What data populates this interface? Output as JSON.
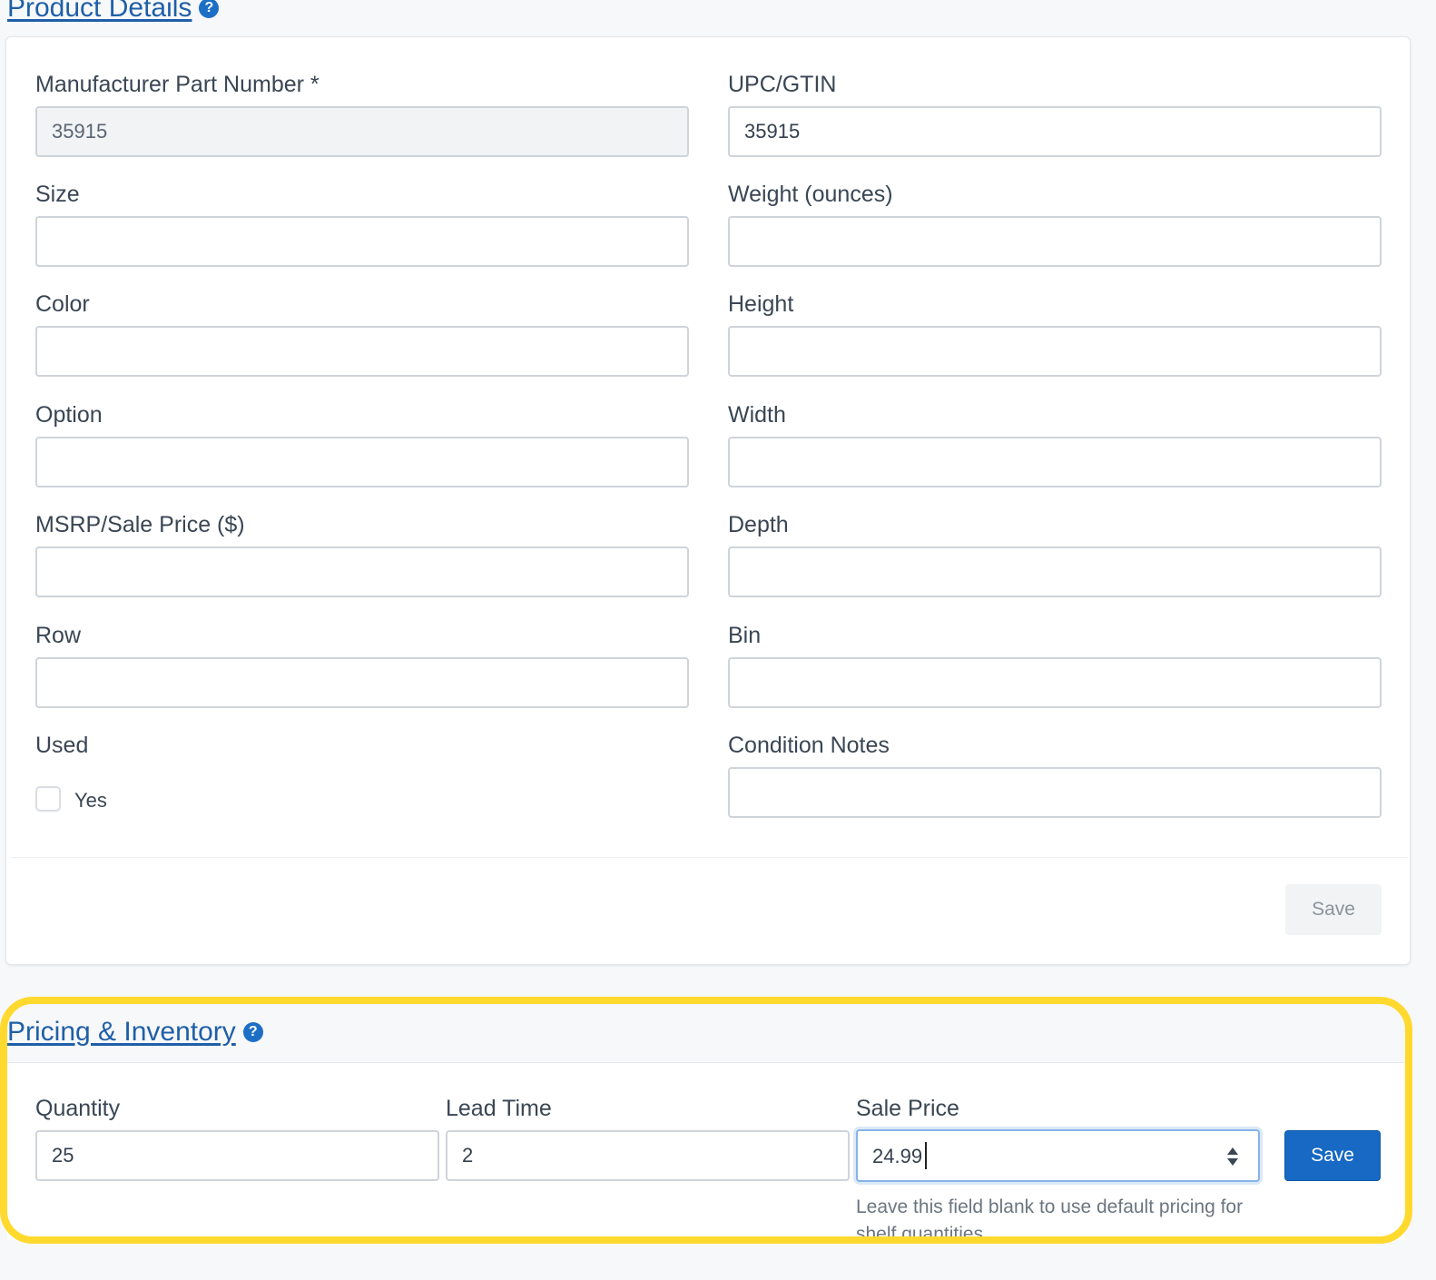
{
  "product_details": {
    "heading": "Product Details",
    "fields": {
      "mpn": {
        "label": "Manufacturer Part Number *",
        "value": "35915"
      },
      "upc": {
        "label": "UPC/GTIN",
        "value": "35915"
      },
      "size": {
        "label": "Size",
        "value": ""
      },
      "weight": {
        "label": "Weight (ounces)",
        "value": ""
      },
      "color": {
        "label": "Color",
        "value": ""
      },
      "height": {
        "label": "Height",
        "value": ""
      },
      "option": {
        "label": "Option",
        "value": ""
      },
      "width": {
        "label": "Width",
        "value": ""
      },
      "msrp": {
        "label": "MSRP/Sale Price ($)",
        "value": ""
      },
      "depth": {
        "label": "Depth",
        "value": ""
      },
      "row": {
        "label": "Row",
        "value": ""
      },
      "bin": {
        "label": "Bin",
        "value": ""
      },
      "used": {
        "label": "Used",
        "checkbox_label": "Yes",
        "checked": false
      },
      "condition_notes": {
        "label": "Condition Notes",
        "value": ""
      }
    },
    "save_label": "Save"
  },
  "pricing_inventory": {
    "heading": "Pricing & Inventory",
    "quantity": {
      "label": "Quantity",
      "value": "25"
    },
    "lead_time": {
      "label": "Lead Time",
      "value": "2"
    },
    "sale_price": {
      "label": "Sale Price",
      "value": "24.99",
      "helper": "Leave this field blank to use default pricing for shelf quantities"
    },
    "save_label": "Save"
  },
  "colors": {
    "primary": "#1769c3",
    "highlight": "#ffd92e",
    "link": "#1f5fa8"
  }
}
